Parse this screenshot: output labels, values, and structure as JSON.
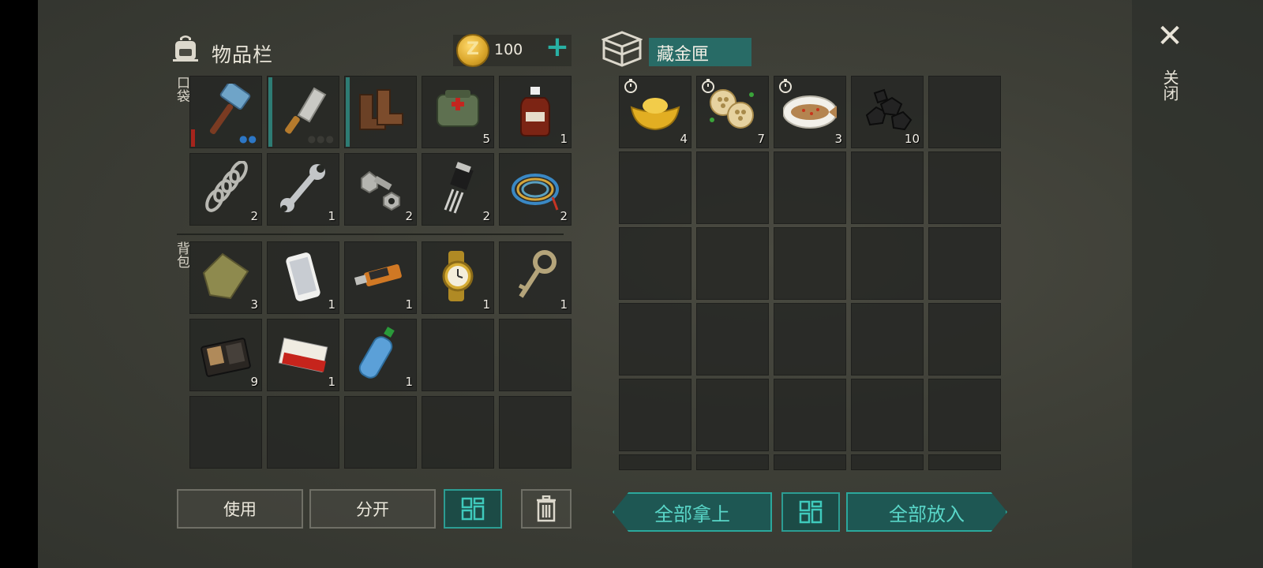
{
  "inventory": {
    "title": "物品栏",
    "coins": "100",
    "coin_letter": "Z",
    "add_symbol": "+",
    "pocket_label": "口袋",
    "backpack_label": "背包",
    "pocket_items": [
      {
        "name": "hammer",
        "count": ""
      },
      {
        "name": "cleaver",
        "count": ""
      },
      {
        "name": "boots",
        "count": ""
      },
      {
        "name": "first-aid-bag",
        "count": "5"
      },
      {
        "name": "spirit-bottle",
        "count": "1"
      },
      {
        "name": "spring",
        "count": "2"
      },
      {
        "name": "wrench",
        "count": "1"
      },
      {
        "name": "bolt-nut",
        "count": "2"
      },
      {
        "name": "transistor",
        "count": "2"
      },
      {
        "name": "wire-coil",
        "count": "2"
      }
    ],
    "backpack_items": [
      {
        "name": "cloth",
        "count": "3"
      },
      {
        "name": "smartphone",
        "count": "1"
      },
      {
        "name": "usb-drive",
        "count": "1"
      },
      {
        "name": "gold-watch",
        "count": "1"
      },
      {
        "name": "old-key",
        "count": "1"
      },
      {
        "name": "wallet",
        "count": "9"
      },
      {
        "name": "cigarette-pack",
        "count": "1"
      },
      {
        "name": "water-bottle",
        "count": "1"
      }
    ],
    "buttons": {
      "use": "使用",
      "split": "分开"
    }
  },
  "container": {
    "name": "藏金匣",
    "items": [
      {
        "name": "gold-ingot",
        "count": "4"
      },
      {
        "name": "lotus-root-dish",
        "count": "7"
      },
      {
        "name": "steamed-fish-dish",
        "count": "3"
      },
      {
        "name": "coal",
        "count": "10"
      }
    ],
    "buttons": {
      "take_all": "全部拿上",
      "put_all": "全部放入"
    }
  },
  "close": {
    "symbol": "✕",
    "label": "关闭"
  },
  "colors": {
    "accent": "#2ba89c",
    "durability_red": "#a5241c",
    "coin_gold": "#d9a52a"
  }
}
